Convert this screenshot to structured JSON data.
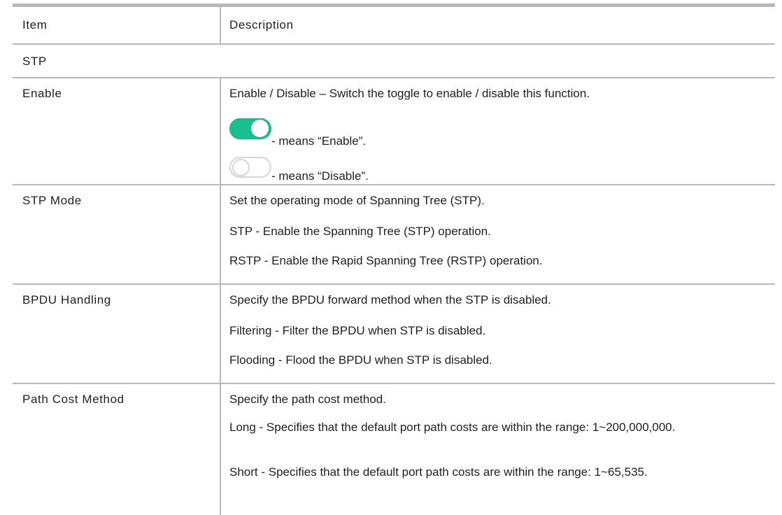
{
  "table": {
    "header": {
      "item": "Item",
      "description": "Description"
    },
    "section": "STP",
    "rows": {
      "enable": {
        "item": "Enable",
        "lines": [
          "Enable / Disable – Switch the toggle to enable / disable this function.",
          "- means “Enable”.",
          "- means “Disable”."
        ],
        "toggle_on_color": "#17c08c",
        "toggle_off_color": "#ffffff"
      },
      "stp_mode": {
        "item": "STP Mode",
        "lines": [
          "Set the operating mode of Spanning Tree (STP).",
          "STP - Enable the Spanning Tree (STP) operation.",
          "RSTP - Enable the Rapid Spanning Tree (RSTP) operation."
        ]
      },
      "bpdu_handling": {
        "item": "BPDU Handling",
        "lines": [
          "Specify the BPDU forward method when the STP is disabled.",
          "Filtering - Filter the BPDU when STP is disabled.",
          "Flooding - Flood the BPDU when STP is disabled."
        ]
      },
      "path_cost_method": {
        "item": "Path Cost Method",
        "lines": [
          "Specify the path cost method.",
          "Long - Specifies that the default port path costs are within the range: 1~200,000,000.",
          "Short - Specifies that the default port path costs are within the range: 1~65,535."
        ]
      }
    },
    "border_color": "#b8b8b8"
  }
}
